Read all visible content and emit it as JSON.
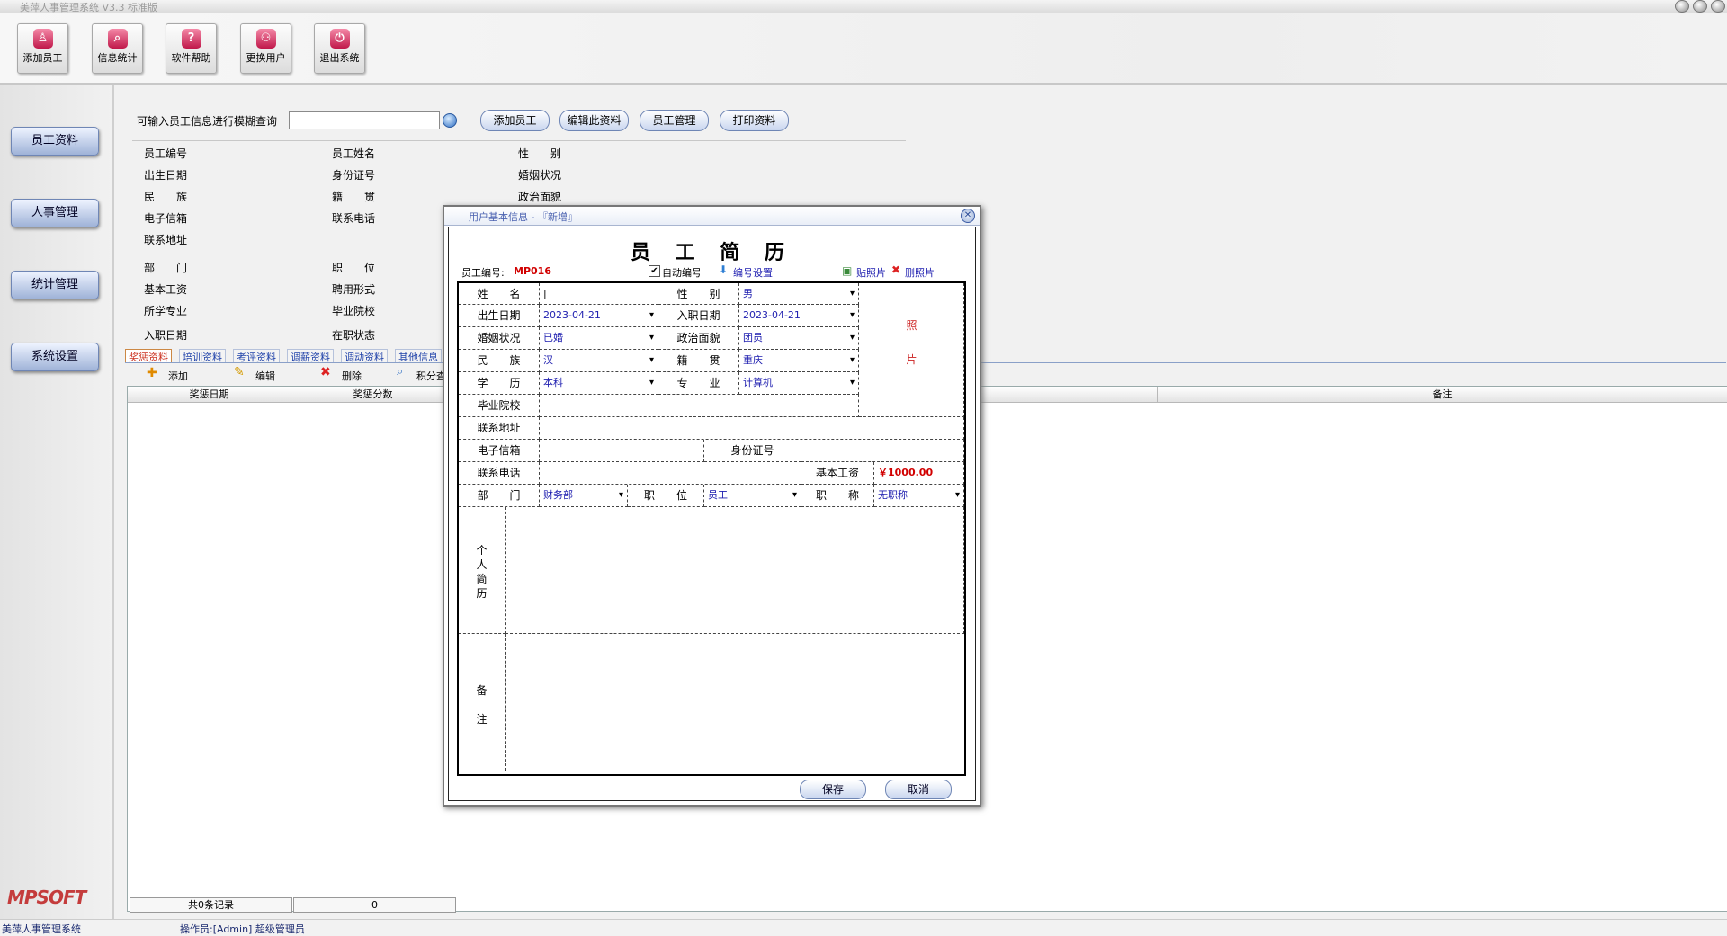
{
  "window": {
    "title": "美萍人事管理系统  V3.3  标准版"
  },
  "toolbar": {
    "buttons": [
      {
        "label": "添加员工",
        "icon": "person-add-icon"
      },
      {
        "label": "信息统计",
        "icon": "search-stats-icon"
      },
      {
        "label": "软件帮助",
        "icon": "help-icon"
      },
      {
        "label": "更换用户",
        "icon": "switch-user-icon"
      },
      {
        "label": "退出系统",
        "icon": "power-icon"
      }
    ]
  },
  "sidebar": {
    "items": [
      "员工资料",
      "人事管理",
      "统计管理",
      "系统设置"
    ],
    "logo": "MPSOFT"
  },
  "search": {
    "prompt": "可输入员工信息进行模糊查询",
    "value": "",
    "placeholder": ""
  },
  "actions": [
    "添加员工",
    "编辑此资料",
    "员工管理",
    "打印资料"
  ],
  "info_labels": {
    "col1": [
      "员工编号",
      "出生日期",
      "民　　族",
      "电子信箱",
      "联系地址"
    ],
    "col2": [
      "员工姓名",
      "身份证号",
      "籍　　贯",
      "联系电话"
    ],
    "col3": [
      "性　　别",
      "婚姻状况",
      "政治面貌"
    ],
    "col4": [
      "部　　门",
      "基本工资",
      "所学专业",
      "入职日期"
    ],
    "col5": [
      "职　　位",
      "聘用形式",
      "毕业院校",
      "在职状态"
    ]
  },
  "tabs": [
    "奖惩资料",
    "培训资料",
    "考评资料",
    "调薪资料",
    "调动资料",
    "其他信息"
  ],
  "subtoolbar": {
    "add": "添加",
    "edit": "编辑",
    "delete": "删除",
    "points": "积分查"
  },
  "grid": {
    "headers": [
      "奖惩日期",
      "奖惩分数",
      "备注"
    ],
    "footer_count": "共0条记录",
    "footer_sum": "0"
  },
  "status": {
    "app": "美萍人事管理系统",
    "operator": "操作员:[Admin] 超级管理员"
  },
  "dialog": {
    "title": "用户基本信息 - 『新增』",
    "heading": "员 工 简 历",
    "emp_no_label": "员工编号:",
    "emp_no": "MP016",
    "auto_number": "自动编号",
    "number_setting": "编号设置",
    "paste_photo": "贴照片",
    "delete_photo": "删照片",
    "photo_label_1": "照",
    "photo_label_2": "片",
    "fields": {
      "name": {
        "label": "姓　　名",
        "value": "|"
      },
      "gender": {
        "label": "性　　别",
        "value": "男"
      },
      "birth": {
        "label": "出生日期",
        "value": "2023-04-21"
      },
      "hire": {
        "label": "入职日期",
        "value": "2023-04-21"
      },
      "marital": {
        "label": "婚姻状况",
        "value": "已婚"
      },
      "political": {
        "label": "政治面貌",
        "value": "团员"
      },
      "ethnic": {
        "label": "民　　族",
        "value": "汉"
      },
      "origin": {
        "label": "籍　　贯",
        "value": "重庆"
      },
      "education": {
        "label": "学　　历",
        "value": "本科"
      },
      "major": {
        "label": "专　　业",
        "value": "计算机"
      },
      "school": {
        "label": "毕业院校",
        "value": ""
      },
      "address": {
        "label": "联系地址",
        "value": ""
      },
      "email": {
        "label": "电子信箱",
        "value": ""
      },
      "idcard": {
        "label": "身份证号",
        "value": ""
      },
      "phone": {
        "label": "联系电话",
        "value": ""
      },
      "salary": {
        "label": "基本工资",
        "value": "￥1000.00"
      },
      "dept": {
        "label": "部　　门",
        "value": "财务部"
      },
      "position": {
        "label": "职　　位",
        "value": "员工"
      },
      "title": {
        "label": "职　　称",
        "value": "无职称"
      },
      "resume": {
        "label": "个\n人\n简\n历",
        "value": ""
      },
      "remark": {
        "label": "备\n\n注",
        "value": ""
      }
    },
    "save": "保存",
    "cancel": "取消"
  }
}
